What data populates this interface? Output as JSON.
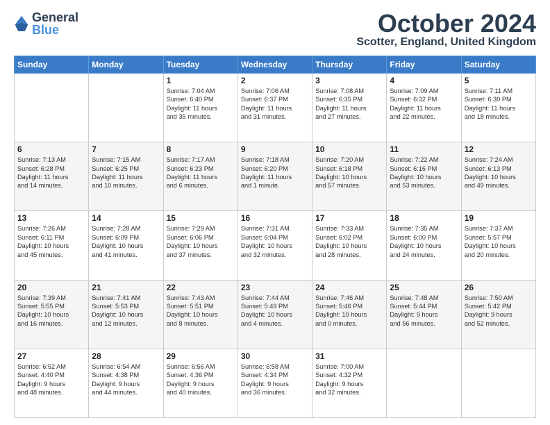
{
  "logo": {
    "general": "General",
    "blue": "Blue"
  },
  "title": "October 2024",
  "location": "Scotter, England, United Kingdom",
  "days_of_week": [
    "Sunday",
    "Monday",
    "Tuesday",
    "Wednesday",
    "Thursday",
    "Friday",
    "Saturday"
  ],
  "weeks": [
    [
      {
        "day": "",
        "text": ""
      },
      {
        "day": "",
        "text": ""
      },
      {
        "day": "1",
        "text": "Sunrise: 7:04 AM\nSunset: 6:40 PM\nDaylight: 11 hours\nand 35 minutes."
      },
      {
        "day": "2",
        "text": "Sunrise: 7:06 AM\nSunset: 6:37 PM\nDaylight: 11 hours\nand 31 minutes."
      },
      {
        "day": "3",
        "text": "Sunrise: 7:08 AM\nSunset: 6:35 PM\nDaylight: 11 hours\nand 27 minutes."
      },
      {
        "day": "4",
        "text": "Sunrise: 7:09 AM\nSunset: 6:32 PM\nDaylight: 11 hours\nand 22 minutes."
      },
      {
        "day": "5",
        "text": "Sunrise: 7:11 AM\nSunset: 6:30 PM\nDaylight: 11 hours\nand 18 minutes."
      }
    ],
    [
      {
        "day": "6",
        "text": "Sunrise: 7:13 AM\nSunset: 6:28 PM\nDaylight: 11 hours\nand 14 minutes."
      },
      {
        "day": "7",
        "text": "Sunrise: 7:15 AM\nSunset: 6:25 PM\nDaylight: 11 hours\nand 10 minutes."
      },
      {
        "day": "8",
        "text": "Sunrise: 7:17 AM\nSunset: 6:23 PM\nDaylight: 11 hours\nand 6 minutes."
      },
      {
        "day": "9",
        "text": "Sunrise: 7:18 AM\nSunset: 6:20 PM\nDaylight: 11 hours\nand 1 minute."
      },
      {
        "day": "10",
        "text": "Sunrise: 7:20 AM\nSunset: 6:18 PM\nDaylight: 10 hours\nand 57 minutes."
      },
      {
        "day": "11",
        "text": "Sunrise: 7:22 AM\nSunset: 6:16 PM\nDaylight: 10 hours\nand 53 minutes."
      },
      {
        "day": "12",
        "text": "Sunrise: 7:24 AM\nSunset: 6:13 PM\nDaylight: 10 hours\nand 49 minutes."
      }
    ],
    [
      {
        "day": "13",
        "text": "Sunrise: 7:26 AM\nSunset: 6:11 PM\nDaylight: 10 hours\nand 45 minutes."
      },
      {
        "day": "14",
        "text": "Sunrise: 7:28 AM\nSunset: 6:09 PM\nDaylight: 10 hours\nand 41 minutes."
      },
      {
        "day": "15",
        "text": "Sunrise: 7:29 AM\nSunset: 6:06 PM\nDaylight: 10 hours\nand 37 minutes."
      },
      {
        "day": "16",
        "text": "Sunrise: 7:31 AM\nSunset: 6:04 PM\nDaylight: 10 hours\nand 32 minutes."
      },
      {
        "day": "17",
        "text": "Sunrise: 7:33 AM\nSunset: 6:02 PM\nDaylight: 10 hours\nand 28 minutes."
      },
      {
        "day": "18",
        "text": "Sunrise: 7:35 AM\nSunset: 6:00 PM\nDaylight: 10 hours\nand 24 minutes."
      },
      {
        "day": "19",
        "text": "Sunrise: 7:37 AM\nSunset: 5:57 PM\nDaylight: 10 hours\nand 20 minutes."
      }
    ],
    [
      {
        "day": "20",
        "text": "Sunrise: 7:39 AM\nSunset: 5:55 PM\nDaylight: 10 hours\nand 16 minutes."
      },
      {
        "day": "21",
        "text": "Sunrise: 7:41 AM\nSunset: 5:53 PM\nDaylight: 10 hours\nand 12 minutes."
      },
      {
        "day": "22",
        "text": "Sunrise: 7:43 AM\nSunset: 5:51 PM\nDaylight: 10 hours\nand 8 minutes."
      },
      {
        "day": "23",
        "text": "Sunrise: 7:44 AM\nSunset: 5:49 PM\nDaylight: 10 hours\nand 4 minutes."
      },
      {
        "day": "24",
        "text": "Sunrise: 7:46 AM\nSunset: 5:46 PM\nDaylight: 10 hours\nand 0 minutes."
      },
      {
        "day": "25",
        "text": "Sunrise: 7:48 AM\nSunset: 5:44 PM\nDaylight: 9 hours\nand 56 minutes."
      },
      {
        "day": "26",
        "text": "Sunrise: 7:50 AM\nSunset: 5:42 PM\nDaylight: 9 hours\nand 52 minutes."
      }
    ],
    [
      {
        "day": "27",
        "text": "Sunrise: 6:52 AM\nSunset: 4:40 PM\nDaylight: 9 hours\nand 48 minutes."
      },
      {
        "day": "28",
        "text": "Sunrise: 6:54 AM\nSunset: 4:38 PM\nDaylight: 9 hours\nand 44 minutes."
      },
      {
        "day": "29",
        "text": "Sunrise: 6:56 AM\nSunset: 4:36 PM\nDaylight: 9 hours\nand 40 minutes."
      },
      {
        "day": "30",
        "text": "Sunrise: 6:58 AM\nSunset: 4:34 PM\nDaylight: 9 hours\nand 36 minutes."
      },
      {
        "day": "31",
        "text": "Sunrise: 7:00 AM\nSunset: 4:32 PM\nDaylight: 9 hours\nand 32 minutes."
      },
      {
        "day": "",
        "text": ""
      },
      {
        "day": "",
        "text": ""
      }
    ]
  ]
}
